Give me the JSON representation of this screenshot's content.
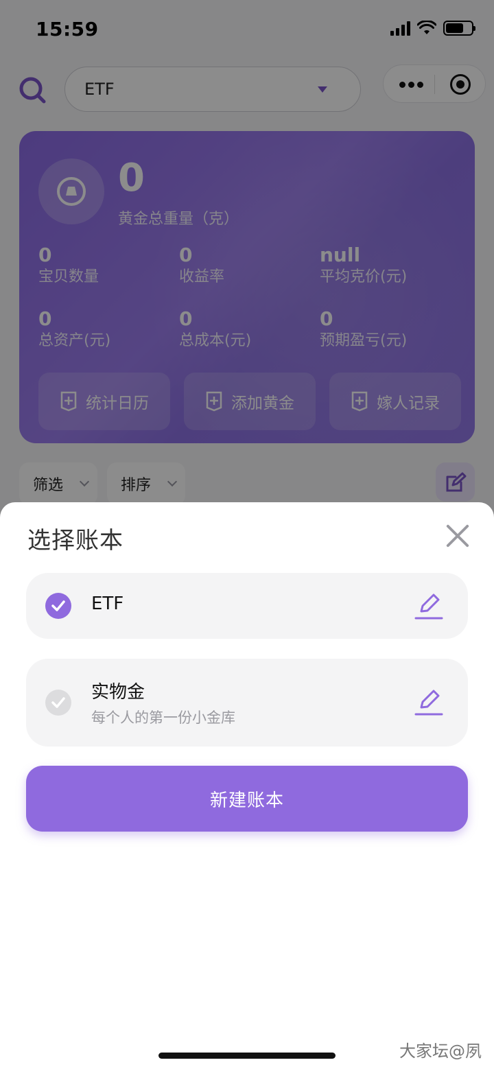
{
  "status_bar": {
    "time": "15:59"
  },
  "header": {
    "selected_ledger": "ETF"
  },
  "summary": {
    "total_weight": "0",
    "total_weight_label": "黄金总重量（克）",
    "stats": [
      {
        "value": "0",
        "label": "宝贝数量"
      },
      {
        "value": "0",
        "label": "收益率"
      },
      {
        "value": "null",
        "label": "平均克价(元)"
      },
      {
        "value": "0",
        "label": "总资产(元)"
      },
      {
        "value": "0",
        "label": "总成本(元)"
      },
      {
        "value": "0",
        "label": "预期盈亏(元)"
      }
    ],
    "actions": [
      {
        "label": "统计日历",
        "icon": "plus-square-icon"
      },
      {
        "label": "添加黄金",
        "icon": "plus-square-icon"
      },
      {
        "label": "嫁人记录",
        "icon": "plus-square-icon"
      }
    ]
  },
  "toolbar": {
    "filter_label": "筛选",
    "sort_label": "排序"
  },
  "sheet": {
    "title": "选择账本",
    "ledgers": [
      {
        "name": "ETF",
        "description": "",
        "selected": true
      },
      {
        "name": "实物金",
        "description": "每个人的第一份小金库",
        "selected": false
      }
    ],
    "new_button_label": "新建账本"
  },
  "watermark": "大家坛@夙",
  "colors": {
    "accent": "#8f6ade",
    "card_bg": "#9378e8",
    "sheet_bg": "#ffffff"
  }
}
